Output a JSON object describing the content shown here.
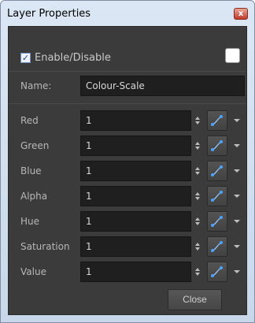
{
  "window": {
    "title": "Layer Properties",
    "close_glyph": "x"
  },
  "enable": {
    "label": "Enable/Disable",
    "checked": true,
    "check_glyph": "✓",
    "swatch_color": "#ffffff"
  },
  "name_field": {
    "label": "Name:",
    "value": "Colour-Scale"
  },
  "params": [
    {
      "label": "Red",
      "value": "1"
    },
    {
      "label": "Green",
      "value": "1"
    },
    {
      "label": "Blue",
      "value": "1"
    },
    {
      "label": "Alpha",
      "value": "1"
    },
    {
      "label": "Hue",
      "value": "1"
    },
    {
      "label": "Saturation",
      "value": "1"
    },
    {
      "label": "Value",
      "value": "1"
    }
  ],
  "footer": {
    "close_label": "Close"
  },
  "icons": {
    "function_curve": "function-curve-icon",
    "spinner": "spinner-icon",
    "dropdown": "chevron-down-icon"
  },
  "colors": {
    "panel_bg": "#3b3b3b",
    "field_bg": "#1f1f1f",
    "accent_blue": "#4aa3ff"
  }
}
